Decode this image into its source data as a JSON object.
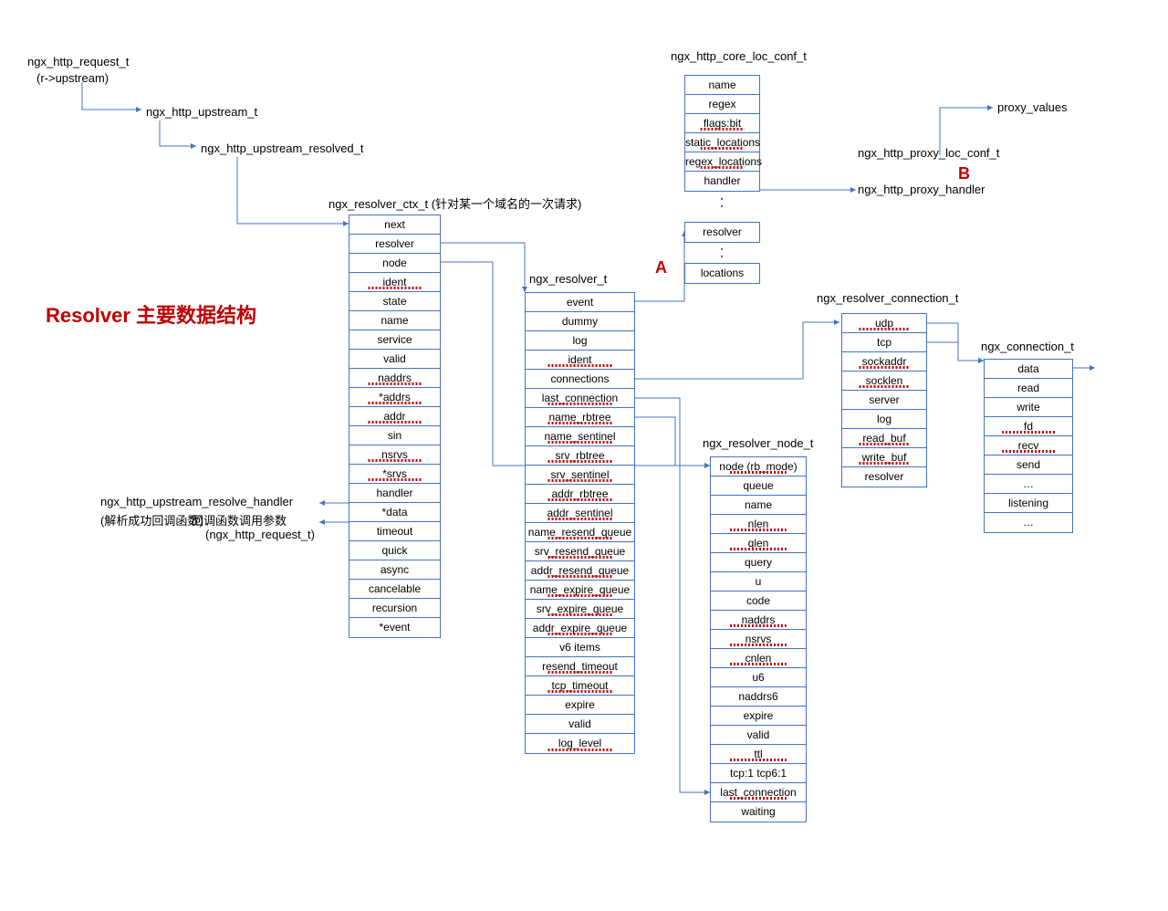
{
  "topLeft": {
    "req": "ngx_http_request_t",
    "reqSub": "(r->upstream)",
    "upstream": "ngx_http_upstream_t",
    "upstreamResolved": "ngx_http_upstream_resolved_t"
  },
  "titleRed": "Resolver 主要数据结构",
  "handlerNote1": "ngx_http_upstream_resolve_handler",
  "handlerNote2": "(解析成功回调函数)",
  "handlerNote3": "回调函数调用参数",
  "handlerNote4": "(ngx_http_request_t)",
  "letterA": "A",
  "letterB": "B",
  "ctx": {
    "title": "ngx_resolver_ctx_t (针对某一个域名的一次请求)",
    "fields": [
      "next",
      "resolver",
      "node",
      "ident",
      "state",
      "name",
      "service",
      "valid",
      "naddrs",
      "*addrs",
      "addr",
      "sin",
      "nsrvs",
      "*srvs",
      "handler",
      "*data",
      "timeout",
      "quick",
      "async",
      "cancelable",
      "recursion",
      "*event"
    ]
  },
  "resolver": {
    "title": "ngx_resolver_t",
    "fields": [
      "event",
      "dummy",
      "log",
      "ident",
      "connections",
      "last_connection",
      "name_rbtree",
      "name_sentinel",
      "srv_rbtree",
      "srv_sentinel",
      "addr_rbtree",
      "addr_sentinel",
      "name_resend_queue",
      "srv_resend_queue",
      "addr_resend_queue",
      "name_expire_queue",
      "srv_expire_queue",
      "addr_expire_queue",
      "v6 items",
      "resend_timeout",
      "tcp_timeout",
      "expire",
      "valid",
      "log_level"
    ]
  },
  "coreLoc": {
    "title": "ngx_http_core_loc_conf_t",
    "fields1": [
      "name",
      "regex",
      "flags:bit",
      "static_locations",
      "regex_locations",
      "handler"
    ],
    "field_resolver": "resolver",
    "field_locations": "locations"
  },
  "proxy": {
    "label": "ngx_http_proxy_loc_conf_t",
    "handler": "ngx_http_proxy_handler",
    "proxyValues": "proxy_values"
  },
  "resolverConn": {
    "title": "ngx_resolver_connection_t",
    "fields": [
      "udp",
      "tcp",
      "sockaddr",
      "socklen",
      "server",
      "log",
      "read_buf",
      "write_buf",
      "resolver"
    ]
  },
  "conn": {
    "title": "ngx_connection_t",
    "fields": [
      "data",
      "read",
      "write",
      "fd",
      "recv",
      "send",
      "…",
      "listening",
      "…"
    ]
  },
  "node": {
    "title": "ngx_resolver_node_t",
    "fields": [
      "node (rb_mode)",
      "queue",
      "name",
      "nlen",
      "qlen",
      "query",
      "u",
      "code",
      "naddrs",
      "nsrvs",
      "cnlen",
      "u6",
      "naddrs6",
      "expire",
      "valid",
      "ttl",
      "tcp:1 tcp6:1",
      "last_connection",
      "waiting"
    ]
  }
}
